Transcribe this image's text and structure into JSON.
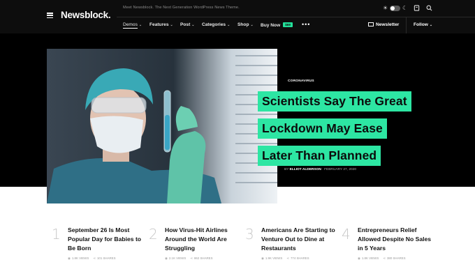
{
  "brand": {
    "logo": "Newsblock.",
    "tagline": "Meet Newsblock. The Next Generation WordPress News Theme."
  },
  "utility": {
    "icons": [
      "sun-icon",
      "theme-toggle",
      "moon-icon",
      "bookmark-icon",
      "search-icon"
    ]
  },
  "nav": {
    "items": [
      {
        "label": "Demos",
        "has_dropdown": true
      },
      {
        "label": "Features",
        "has_dropdown": true
      },
      {
        "label": "Post",
        "has_dropdown": true
      },
      {
        "label": "Categories",
        "has_dropdown": true
      },
      {
        "label": "Shop",
        "has_dropdown": true
      },
      {
        "label": "Buy Now",
        "badge": "$69"
      }
    ],
    "more": "•••",
    "newsletter": "Newsletter",
    "follow": "Follow"
  },
  "hero": {
    "category": "CORONAVIRUS",
    "headline_lines": [
      "Scientists Say The Great",
      "Lockdown May Ease",
      "Later Than Planned"
    ],
    "by": "BY",
    "author": "ELLIOT ALDERSON",
    "date": "FEBRUARY 27, 2020",
    "accent": "#2de6a3"
  },
  "trending": [
    {
      "num": "1",
      "title": "September 26 Is Most Popular Day for Babies to Be Born",
      "views": "1.8K VIEWS",
      "shares": "101 SHARES"
    },
    {
      "num": "2",
      "title": "How Virus-Hit Airlines Around the World Are Struggling",
      "views": "2.1K VIEWS",
      "shares": "862 SHARES"
    },
    {
      "num": "3",
      "title": "Americans Are Starting to Venture Out to Dine at Restaurants",
      "views": "1.9K VIEWS",
      "shares": "774 SHARES"
    },
    {
      "num": "4",
      "title": "Entrepreneurs Relief Allowed Despite No Sales in 5 Years",
      "views": "1.8K VIEWS",
      "shares": "380 SHARES"
    }
  ]
}
